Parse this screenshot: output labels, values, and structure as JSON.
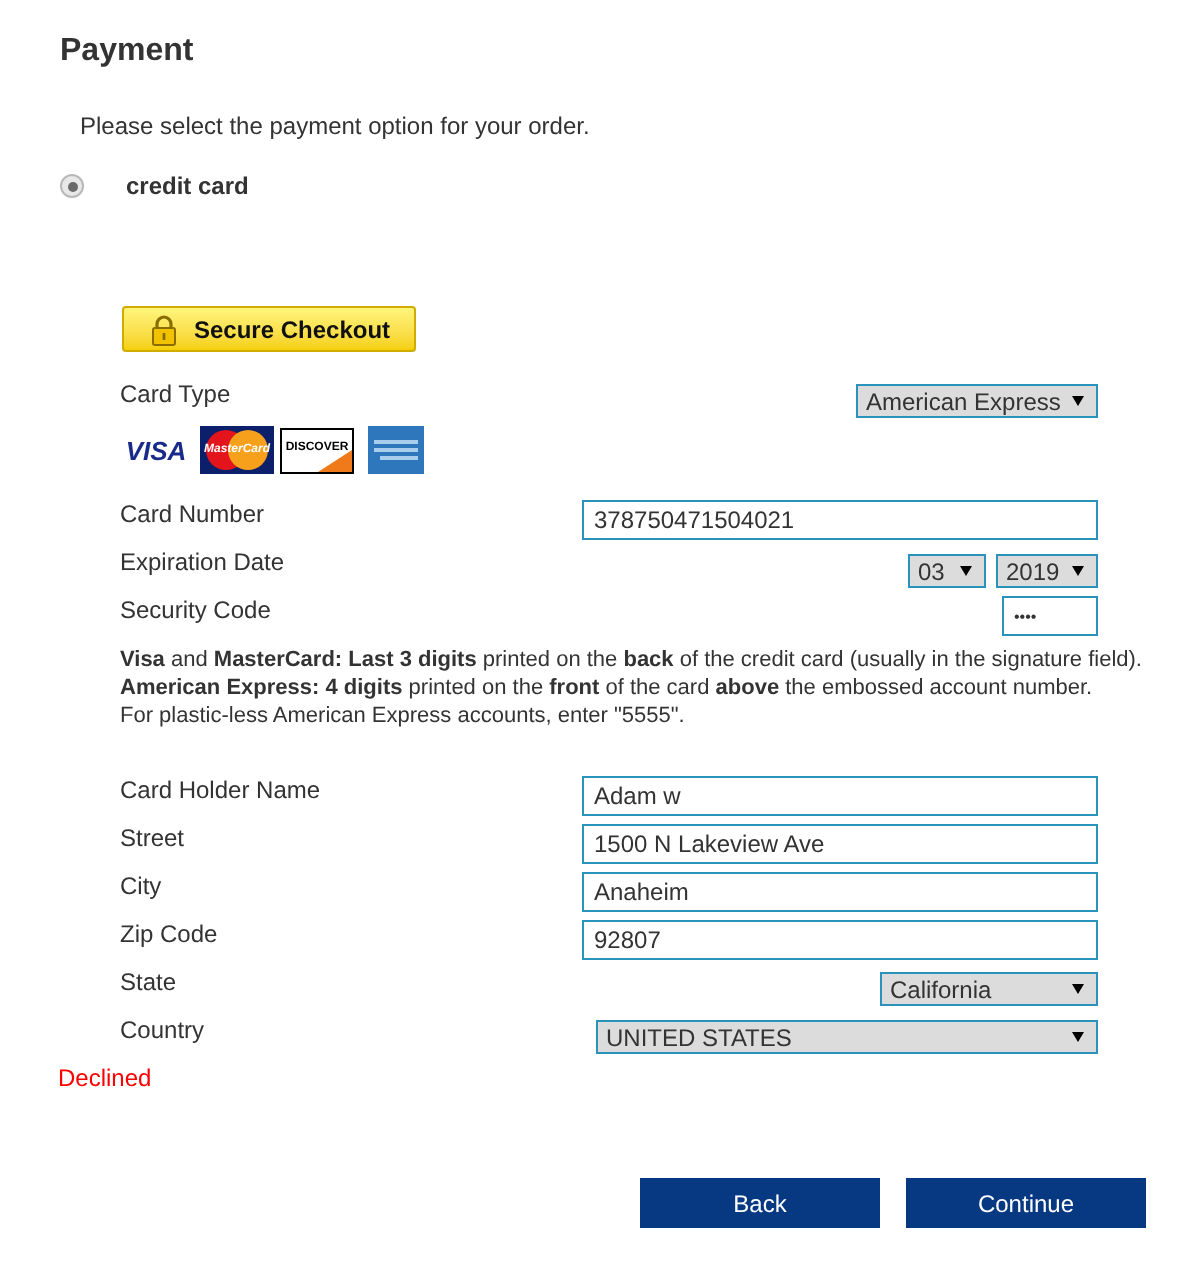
{
  "title": "Payment",
  "instruction": "Please select the payment option for your order.",
  "payment_options": [
    {
      "label": "credit card",
      "selected": true
    }
  ],
  "secure_checkout": {
    "label": "Secure Checkout"
  },
  "card_type": {
    "label": "Card Type",
    "value": "American Express"
  },
  "card_logos": [
    {
      "kind": "visa",
      "text": "VISA"
    },
    {
      "kind": "mastercard",
      "text": "MasterCard"
    },
    {
      "kind": "discover",
      "text": "DISCOVER"
    },
    {
      "kind": "amex"
    }
  ],
  "card_number": {
    "label": "Card Number",
    "value": "378750471504021"
  },
  "expiration": {
    "label": "Expiration Date",
    "month": "03",
    "year": "2019"
  },
  "security_code": {
    "label": "Security Code",
    "value": "••••"
  },
  "security_help": [
    "**Visa** and **MasterCard: Last 3 digits** printed on the **back** of the credit card (usually in the signature field).",
    "**American Express: 4 digits** printed on the **front** of the card **above** the embossed account number.",
    "For plastic-less American Express accounts, enter \"5555\"."
  ],
  "billing_fields": [
    {
      "kind": "text",
      "label": "Card Holder Name",
      "value": "Adam w"
    },
    {
      "kind": "text",
      "label": "Street",
      "value": "1500 N Lakeview Ave"
    },
    {
      "kind": "text",
      "label": "City",
      "value": "Anaheim"
    },
    {
      "kind": "text",
      "label": "Zip Code",
      "value": "92807"
    },
    {
      "kind": "select",
      "label": "State",
      "value": "California"
    },
    {
      "kind": "wide_select",
      "label": "Country",
      "value": "UNITED STATES"
    }
  ],
  "status": {
    "text": "Declined"
  },
  "buttons": [
    {
      "label": "Back"
    },
    {
      "label": "Continue"
    }
  ]
}
